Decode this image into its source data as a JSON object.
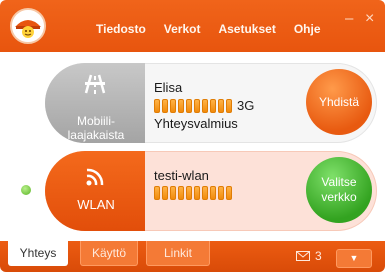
{
  "menu": {
    "items": [
      {
        "label": "Tiedosto"
      },
      {
        "label": "Verkot"
      },
      {
        "label": "Asetukset"
      },
      {
        "label": "Ohje"
      }
    ]
  },
  "window_controls": {
    "minimize": "–",
    "close": "×"
  },
  "connections": [
    {
      "type_label": "Mobiili-\nlaajakaista",
      "network_name": "Elisa",
      "signal_bars": 10,
      "technology": "3G",
      "status": "Yhteysvalmius",
      "action_label": "Yhdistä",
      "icon": "highway-icon"
    },
    {
      "type_label": "WLAN",
      "network_name": "testi-wlan",
      "signal_bars": 10,
      "technology": "",
      "status": "",
      "action_label": "Valitse\nverkko",
      "icon": "wifi-icon",
      "active": true
    }
  ],
  "tabs": [
    {
      "label": "Yhteys",
      "active": true
    },
    {
      "label": "Käyttö",
      "active": false
    },
    {
      "label": "Linkit",
      "active": false
    }
  ],
  "messages": {
    "count": "3",
    "icon": "envelope-icon"
  },
  "expand_button": {
    "glyph": "▼"
  },
  "colors": {
    "brand_orange": "#e8550e",
    "signal_orange": "#f18a0b",
    "select_green": "#33a320"
  }
}
